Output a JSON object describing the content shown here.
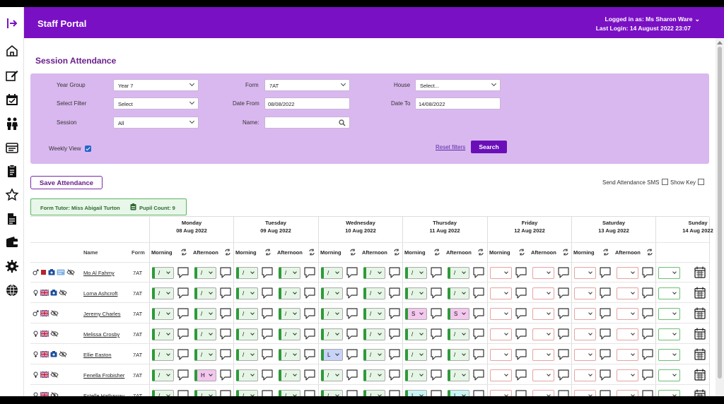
{
  "app": {
    "title": "Staff Portal"
  },
  "user": {
    "logged_in": "Logged in as: Ms Sharon Ware",
    "last_login": "Last Login: 14 August 2022 23:07"
  },
  "sidebar": {
    "icons": [
      "logout-arrow-icon",
      "home-icon",
      "edit-icon",
      "calendar-check-icon",
      "people-icon",
      "id-card-icon",
      "clipboard-icon",
      "star-icon",
      "document-icon",
      "wallet-icon",
      "gear-icon",
      "globe-icon"
    ]
  },
  "page": {
    "title": "Session Attendance"
  },
  "filters": {
    "year_group_label": "Year Group",
    "year_group_value": "Year 7",
    "select_filter_label": "Select Filter",
    "select_filter_value": "Select",
    "session_label": "Session",
    "session_value": "All",
    "form_label": "Form",
    "form_value": "7AT",
    "date_from_label": "Date From",
    "date_from_value": "08/08/2022",
    "name_label": "Name:",
    "name_value": "",
    "house_label": "House",
    "house_value": "Select...",
    "date_to_label": "Date To",
    "date_to_value": "14/08/2022",
    "weekly_view_label": "Weekly View",
    "weekly_view_checked": true,
    "reset_label": "Reset filters",
    "search_label": "Search"
  },
  "actions": {
    "save_label": "Save Attendance",
    "sms_label": "Send Attendance SMS",
    "key_label": "Show Key"
  },
  "tutor": {
    "text": "Form Tutor: Miss Abigail Turton",
    "pupil_count": "Pupil Count: 9"
  },
  "table": {
    "name_header": "Name",
    "form_header": "Form",
    "morning_label": "Morning",
    "afternoon_label": "Afternoon",
    "days": [
      {
        "name": "Monday",
        "date": "08 Aug 2022"
      },
      {
        "name": "Tuesday",
        "date": "09 Aug 2022"
      },
      {
        "name": "Wednesday",
        "date": "10 Aug 2022"
      },
      {
        "name": "Thursday",
        "date": "11 Aug 2022"
      },
      {
        "name": "Friday",
        "date": "12 Aug 2022"
      },
      {
        "name": "Saturday",
        "date": "13 Aug 2022"
      },
      {
        "name": "Sunday",
        "date": "14 Aug 2022"
      }
    ],
    "rows": [
      {
        "name": "Mo Al Fahmy",
        "form": "7AT",
        "icons": [
          "male-icon",
          "red-square-icon",
          "id-badge-icon",
          "id-card-blue-icon",
          "eye-off-icon"
        ],
        "codes": [
          "/",
          "/",
          "/",
          "/",
          "/",
          "/",
          "/",
          "/",
          "",
          "",
          "",
          "",
          ""
        ]
      },
      {
        "name": "Lorna Ashcroft",
        "form": "7AT",
        "icons": [
          "female-icon",
          "uk-flag-icon",
          "id-badge-icon",
          "eye-off-icon"
        ],
        "codes": [
          "/",
          "/",
          "/",
          "/",
          "/",
          "/",
          "/",
          "/",
          "",
          "",
          "",
          "",
          ""
        ]
      },
      {
        "name": "Jeremy Charles",
        "form": "7AT",
        "icons": [
          "male-icon",
          "uk-flag-icon",
          "eye-off-icon"
        ],
        "codes": [
          "/",
          "/",
          "/",
          "/",
          "/",
          "/",
          "S",
          "S",
          "",
          "",
          "",
          "",
          ""
        ]
      },
      {
        "name": "Melissa Crosby",
        "form": "7AT",
        "icons": [
          "female-icon",
          "uk-flag-icon",
          "eye-off-icon"
        ],
        "codes": [
          "/",
          "/",
          "/",
          "/",
          "/",
          "/",
          "/",
          "/",
          "",
          "",
          "",
          "",
          ""
        ]
      },
      {
        "name": "Ellie Easton",
        "form": "7AT",
        "icons": [
          "female-icon",
          "uk-flag-icon",
          "id-badge-icon",
          "eye-off-icon"
        ],
        "codes": [
          "/",
          "/",
          "/",
          "/",
          "L",
          "/",
          "/",
          "/",
          "",
          "",
          "",
          "",
          ""
        ]
      },
      {
        "name": "Fenella Frobisher",
        "form": "7AT",
        "icons": [
          "female-icon",
          "uk-flag-icon",
          "eye-off-icon"
        ],
        "codes": [
          "/",
          "H",
          "/",
          "/",
          "/",
          "/",
          "/",
          "/",
          "",
          "",
          "",
          "",
          ""
        ]
      },
      {
        "name": "Estelle Hathaway",
        "form": "7AT",
        "icons": [
          "female-icon",
          "uk-flag-icon",
          "eye-off-icon"
        ],
        "codes": [
          "/",
          "/",
          "/",
          "/",
          "/",
          "/",
          "I",
          "I",
          "",
          "",
          "",
          "",
          ""
        ]
      }
    ]
  },
  "colors": {
    "header": "#7a10c4",
    "panel": "#d9b8ef",
    "present": "#2e9a3a",
    "title": "#6a1f8a"
  }
}
